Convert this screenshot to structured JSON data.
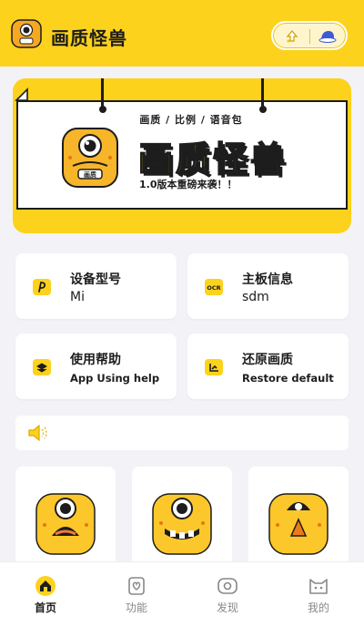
{
  "header": {
    "title": "画质怪兽",
    "brand_color": "#fcd21c",
    "capsule_left_icon": "lightbulb-icon",
    "capsule_right_icon": "hat-icon"
  },
  "banner": {
    "tags": "画质  /  比例  /  语音包",
    "big_title": "画质怪兽",
    "subtitle": "1.0版本重磅来袭！！",
    "mascot_badge": "画质"
  },
  "cards": [
    {
      "title": "设备型号",
      "value": "Mi",
      "icon": "phone-brand-icon"
    },
    {
      "title": "主板信息",
      "value": "sdm",
      "icon": "ocr-chip-icon",
      "icon_text": "OCR"
    },
    {
      "title": "使用帮助",
      "value": "App Using help",
      "icon": "book-help-icon"
    },
    {
      "title": "还原画质",
      "value": "Restore default",
      "icon": "restore-chart-icon"
    }
  ],
  "notice": {
    "icon": "speaker-icon",
    "text": ""
  },
  "monsters": [
    {
      "name": "monster-shout"
    },
    {
      "name": "monster-teeth"
    },
    {
      "name": "monster-alarm"
    }
  ],
  "tabs": [
    {
      "label": "首页",
      "icon": "home-icon",
      "active": true
    },
    {
      "label": "功能",
      "icon": "feature-heart-icon",
      "active": false
    },
    {
      "label": "发现",
      "icon": "discover-eye-icon",
      "active": false
    },
    {
      "label": "我的",
      "icon": "profile-cat-icon",
      "active": false
    }
  ]
}
